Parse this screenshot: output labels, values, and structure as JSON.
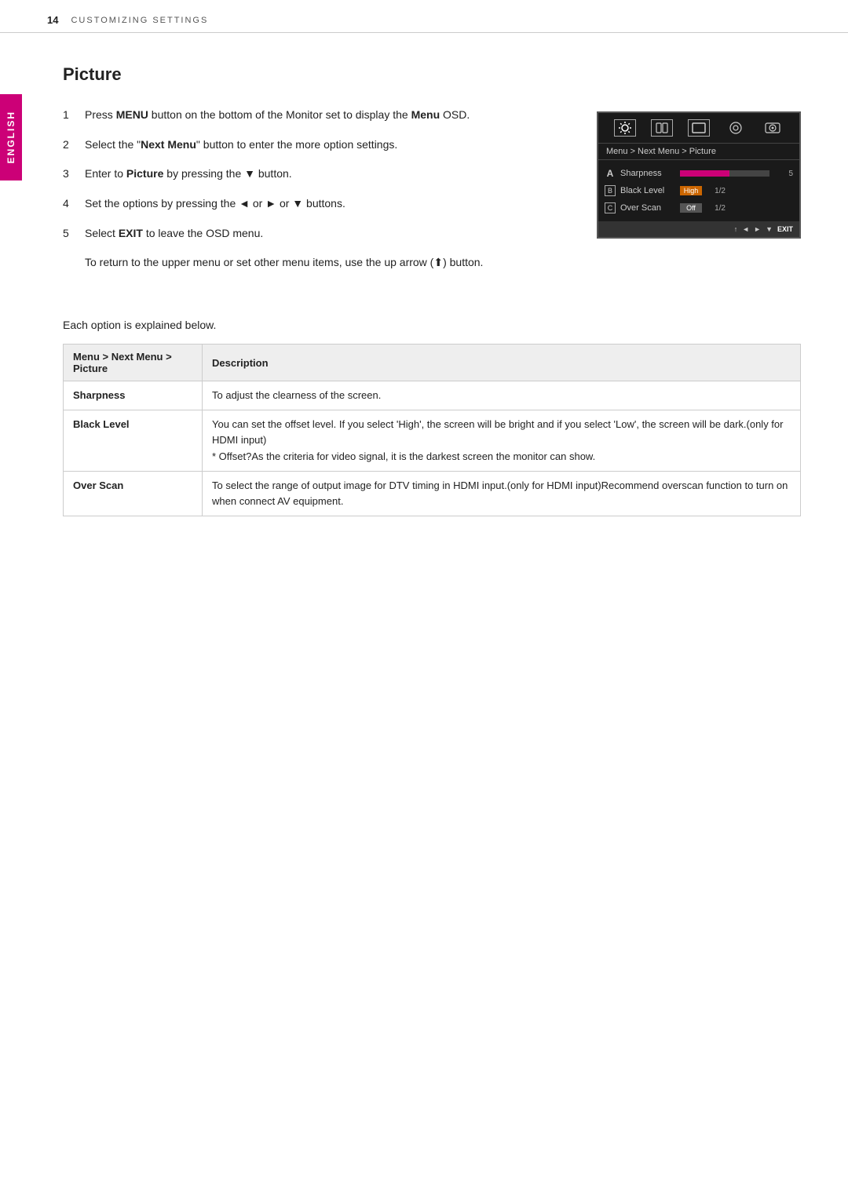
{
  "header": {
    "page_number": "14",
    "section_title": "CUSTOMIZING SETTINGS"
  },
  "english_tab": {
    "label": "ENGLISH"
  },
  "section": {
    "title": "Picture"
  },
  "steps": [
    {
      "number": "1",
      "html": "Press <b>MENU</b> button on the bottom of the Monitor set to display the <b>Menu</b> OSD."
    },
    {
      "number": "2",
      "html": "Select the \"<b>Next Menu</b>\" button to enter the more option settings."
    },
    {
      "number": "3",
      "html": "Enter to <b>Picture</b> by pressing the ▼ button."
    },
    {
      "number": "4",
      "html": "Set the options by pressing the ◄ or ► or ▼ buttons."
    },
    {
      "number": "5",
      "html": "Select <b>EXIT</b> to leave the OSD menu."
    }
  ],
  "return_note": "To return to the upper menu or set other menu items, use the up arrow (&#x2662;) button.",
  "osd": {
    "breadcrumb": "Menu > Next Menu > Picture",
    "rows": [
      {
        "icon": "A",
        "label": "Sharpness",
        "bar_type": "fill",
        "bar_pct": 55,
        "value": "5",
        "right_val": ""
      },
      {
        "icon": "B",
        "label": "Black Level",
        "bar_type": "text",
        "bar_text": "High",
        "value": "1/2",
        "right_val": "1/2"
      },
      {
        "icon": "C",
        "label": "Over Scan",
        "bar_type": "text_off",
        "bar_text": "Off",
        "value": "1/2",
        "right_val": "1/2"
      }
    ],
    "footer_buttons": [
      "↑",
      "◄",
      "►",
      "▼",
      "EXIT"
    ]
  },
  "each_option_note": "Each option is explained below.",
  "table": {
    "col1_header": "Menu > Next Menu > Picture",
    "col2_header": "Description",
    "rows": [
      {
        "feature": "Sharpness",
        "description": "To adjust the clearness of the screen."
      },
      {
        "feature": "Black Level",
        "description": "You can set the offset level. If you select 'High', the screen will be bright and if you select 'Low', the screen will be dark.(only for HDMI input)\n* Offset?As the criteria for video signal, it is the darkest screen the monitor can show."
      },
      {
        "feature": "Over Scan",
        "description": "To select the range of output image for DTV timing in HDMI input.(only for HDMI input)Recommend overscan function to turn on when connect AV equipment."
      }
    ]
  }
}
